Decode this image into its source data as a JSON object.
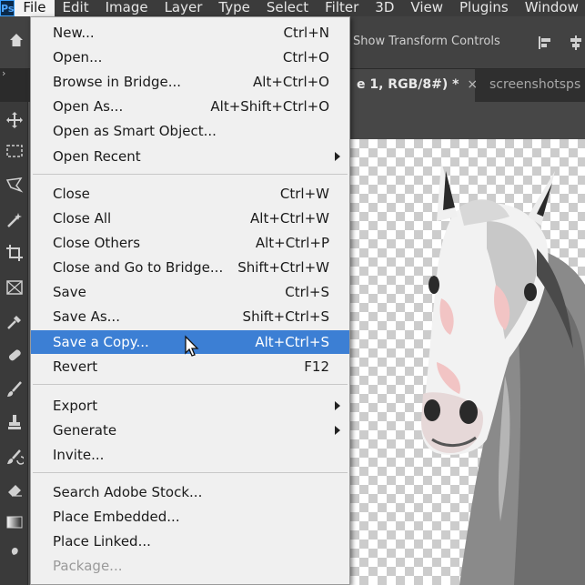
{
  "app": {
    "logo": "Ps"
  },
  "menubar": {
    "items": [
      "File",
      "Edit",
      "Image",
      "Layer",
      "Type",
      "Select",
      "Filter",
      "3D",
      "View",
      "Plugins",
      "Window"
    ]
  },
  "options": {
    "show_transform_controls": "Show Transform Controls"
  },
  "tabs": [
    {
      "label": "e 1, RGB/8#) *",
      "close": "×"
    },
    {
      "label": "screenshotsps"
    }
  ],
  "left_strip": {
    "collapse": "›"
  },
  "file_menu": {
    "groups": [
      [
        {
          "label": "New...",
          "shortcut": "Ctrl+N"
        },
        {
          "label": "Open...",
          "shortcut": "Ctrl+O"
        },
        {
          "label": "Browse in Bridge...",
          "shortcut": "Alt+Ctrl+O"
        },
        {
          "label": "Open As...",
          "shortcut": "Alt+Shift+Ctrl+O"
        },
        {
          "label": "Open as Smart Object...",
          "shortcut": ""
        },
        {
          "label": "Open Recent",
          "shortcut": "",
          "submenu": true
        }
      ],
      [
        {
          "label": "Close",
          "shortcut": "Ctrl+W"
        },
        {
          "label": "Close All",
          "shortcut": "Alt+Ctrl+W"
        },
        {
          "label": "Close Others",
          "shortcut": "Alt+Ctrl+P"
        },
        {
          "label": "Close and Go to Bridge...",
          "shortcut": "Shift+Ctrl+W"
        },
        {
          "label": "Save",
          "shortcut": "Ctrl+S"
        },
        {
          "label": "Save As...",
          "shortcut": "Shift+Ctrl+S"
        },
        {
          "label": "Save a Copy...",
          "shortcut": "Alt+Ctrl+S",
          "highlighted": true
        },
        {
          "label": "Revert",
          "shortcut": "F12"
        }
      ],
      [
        {
          "label": "Export",
          "shortcut": "",
          "submenu": true
        },
        {
          "label": "Generate",
          "shortcut": "",
          "submenu": true
        },
        {
          "label": "Invite...",
          "shortcut": ""
        }
      ],
      [
        {
          "label": "Search Adobe Stock...",
          "shortcut": ""
        },
        {
          "label": "Place Embedded...",
          "shortcut": ""
        },
        {
          "label": "Place Linked...",
          "shortcut": ""
        },
        {
          "label": "Package...",
          "shortcut": "",
          "disabled": true
        }
      ]
    ]
  },
  "toolbar": {
    "tools": [
      "move-tool-icon",
      "marquee-tool-icon",
      "lasso-tool-icon",
      "magic-wand-tool-icon",
      "crop-tool-icon",
      "frame-tool-icon",
      "eyedropper-tool-icon",
      "healing-brush-tool-icon",
      "brush-tool-icon",
      "clone-stamp-tool-icon",
      "history-brush-tool-icon",
      "eraser-tool-icon",
      "gradient-tool-icon",
      "smudge-tool-icon"
    ]
  },
  "colors": {
    "highlight": "#3c7fd4",
    "menu_bg": "#f0f0f0",
    "app_bg": "#535353"
  }
}
